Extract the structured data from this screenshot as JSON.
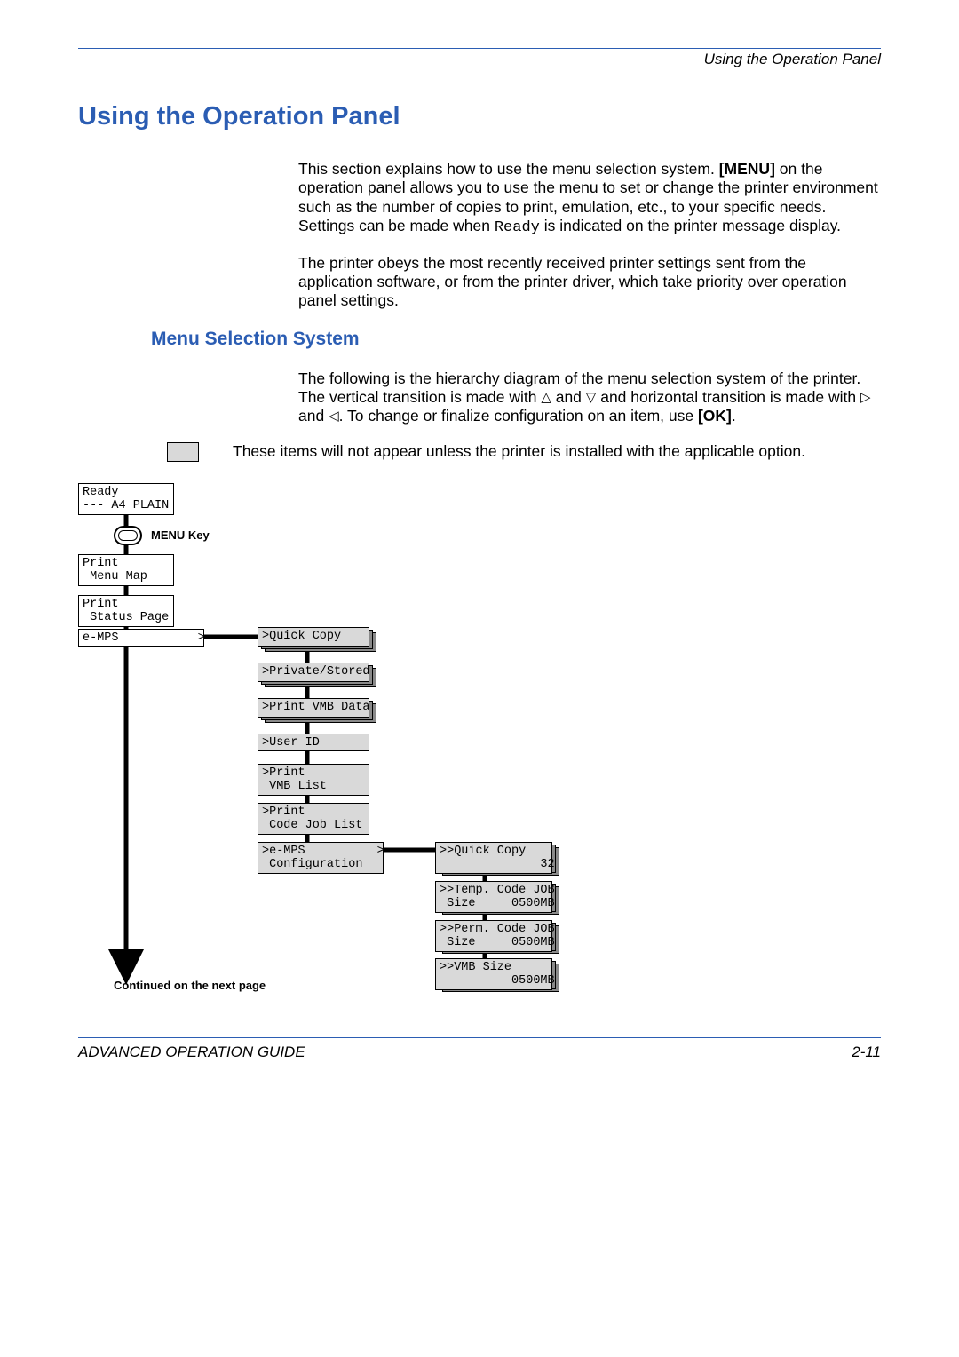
{
  "header": {
    "running": "Using the Operation Panel"
  },
  "title": "Using the Operation Panel",
  "para1a": "This section explains how to use the menu selection system. ",
  "para1b": "[MENU]",
  "para1c": " on the operation panel allows you to use the menu to set or change the printer environment such as the number of copies to print, emulation, etc., to your specific needs. Settings can be made when ",
  "para1d": "Ready",
  "para1e": " is indicated on the printer message display.",
  "para2": "The printer obeys the most recently received printer settings sent from the application software, or from the printer driver, which take priority over operation panel settings.",
  "h2": "Menu Selection System",
  "para3a": "The following is the hierarchy diagram of the menu selection system of the printer. The vertical transition is made with ",
  "para3b": " and ",
  "para3c": " and horizontal transition is made with ",
  "para3d": " and ",
  "para3e": ". To change or finalize configuration on an item, use ",
  "para3f": "[OK]",
  "para3g": ".",
  "note": "These items will not appear unless the printer is installed with the applicable option.",
  "diagram": {
    "ready": "Ready\n--- A4 PLAIN",
    "menu_key": "MENU Key",
    "print_menu_map": "Print\n Menu Map",
    "print_status": "Print\n Status Page",
    "emps": "e-MPS           >",
    "quick_copy": ">Quick Copy",
    "private_stored": ">Private/Stored",
    "print_vmb_data": ">Print VMB Data",
    "user_id": ">User ID",
    "print_vmb_list": ">Print\n VMB List",
    "print_code_job": ">Print\n Code Job List",
    "emps_config": ">e-MPS          >\n Configuration",
    "qc32": ">>Quick Copy\n              32",
    "temp": ">>Temp. Code JOB\n Size     0500MB",
    "perm": ">>Perm. Code JOB\n Size     0500MB",
    "vmbsize": ">>VMB Size\n          0500MB",
    "continued": "Continued on the next page"
  },
  "footer": {
    "left": "ADVANCED OPERATION GUIDE",
    "right": "2-11"
  }
}
